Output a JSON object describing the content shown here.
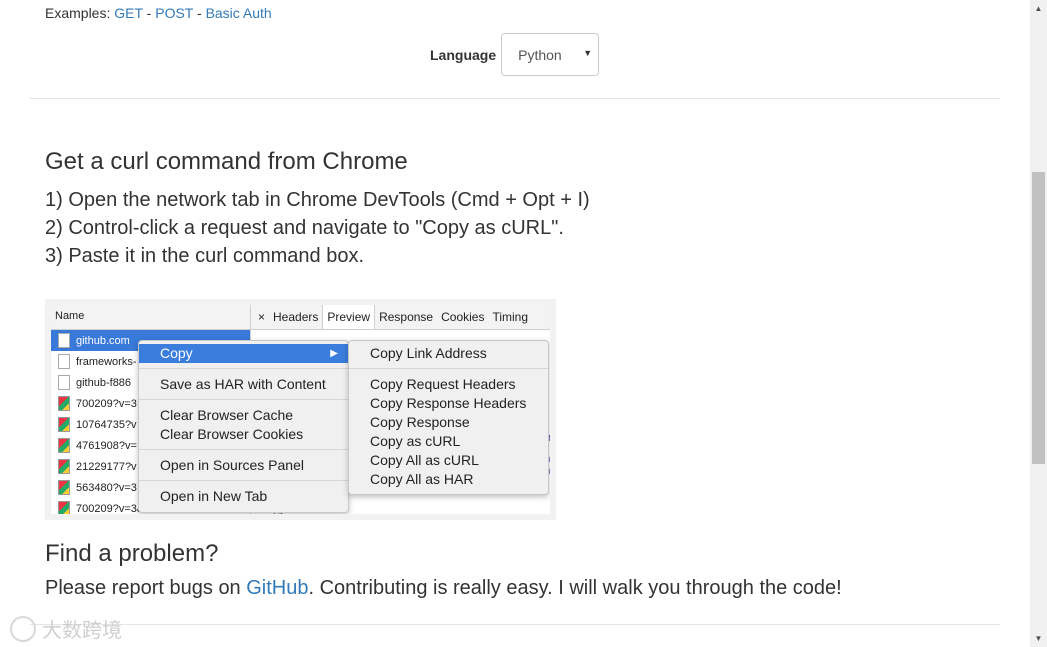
{
  "examples": {
    "label": "Examples:",
    "links": [
      "GET",
      "POST",
      "Basic Auth"
    ],
    "separator": "-"
  },
  "language": {
    "label": "Language",
    "selected": "Python"
  },
  "chrome_section": {
    "heading": "Get a curl command from Chrome",
    "steps": [
      "1) Open the network tab in Chrome DevTools (Cmd + Opt + I)",
      "2) Control-click a request and navigate to \"Copy as cURL\".",
      "3) Paste it in the curl command box."
    ]
  },
  "devtools_shot": {
    "name_header": "Name",
    "close": "×",
    "tabs": [
      "Headers",
      "Preview",
      "Response",
      "Cookies",
      "Timing"
    ],
    "active_tab": "Preview",
    "rows": [
      "github.com",
      "frameworks-",
      "github-f886",
      "700209?v=3",
      "10764735?v",
      "4761908?v=",
      "21229177?v",
      "563480?v=3",
      "700209?v=3&s=32"
    ],
    "row_number": "14",
    "code_fragments": [
      ".n",
      "'h",
      "'h"
    ],
    "context_menu": {
      "items": [
        "Copy",
        "Save as HAR with Content",
        "Clear Browser Cache",
        "Clear Browser Cookies",
        "Open in Sources Panel",
        "Open in New Tab"
      ],
      "submenu_arrow": "▶"
    },
    "copy_submenu": {
      "items": [
        "Copy Link Address",
        "Copy Request Headers",
        "Copy Response Headers",
        "Copy Response",
        "Copy as cURL",
        "Copy All as cURL",
        "Copy All as HAR"
      ]
    }
  },
  "problem_section": {
    "heading": "Find a problem?",
    "text_before": "Please report bugs on ",
    "link": "GitHub",
    "text_after": ". Contributing is really easy. I will walk you through the code!"
  },
  "watermark": "大数跨境",
  "colors": {
    "link": "#337ab7",
    "selection": "#3879d9",
    "menu_highlight": "#3b7ddd"
  }
}
